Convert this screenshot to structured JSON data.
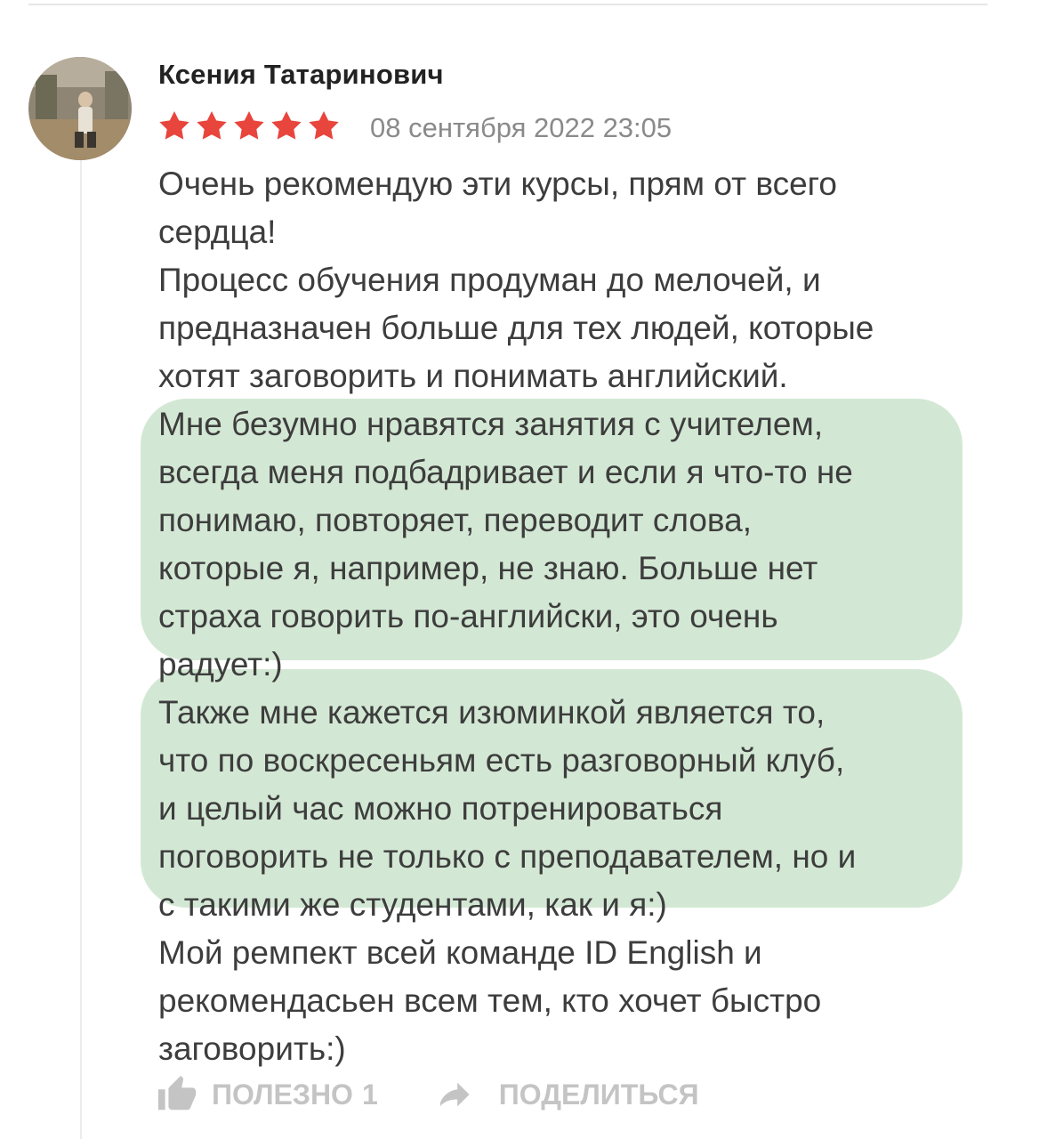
{
  "review": {
    "author": "Ксения Татаринович",
    "rating": 5,
    "date": "08 сентября 2022 23:05",
    "body_lines": [
      "Очень рекомендую эти курсы, прям от всего",
      "сердца!",
      "Процесс обучения продуман до мелочей, и",
      "предназначен больше для тех людей, которые",
      "хотят заговорить и понимать английский.",
      "Мне безумно нравятся занятия с учителем,",
      "всегда меня подбадривает и если я что-то не",
      "понимаю, повторяет, переводит слова,",
      "которые я, например, не знаю. Больше нет",
      "страха говорить по-английски, это очень",
      "радует:)",
      "Также мне кажется изюминкой является то,",
      "что по воскресеньям есть разговорный клуб,",
      "и целый час можно потренироваться",
      "поговорить не только с преподавателем, но и",
      "с такими же студентами, как и я:)",
      "Мой ремпект всей команде ID English и",
      "рекомендасьен всем тем, кто хочет быстро",
      "заговорить:)"
    ]
  },
  "actions": {
    "helpful_label": "ПОЛЕЗНО",
    "helpful_count": "1",
    "share_label": "ПОДЕЛИТЬСЯ"
  },
  "icons": {
    "star": "star-icon",
    "helpful": "thumbs-up-icon",
    "share": "share-arrow-icon"
  },
  "colors": {
    "star": "#e8453c",
    "highlight": "#d3e8d4",
    "action_text": "#c4c4c4",
    "date_text": "#8a8a8a"
  }
}
